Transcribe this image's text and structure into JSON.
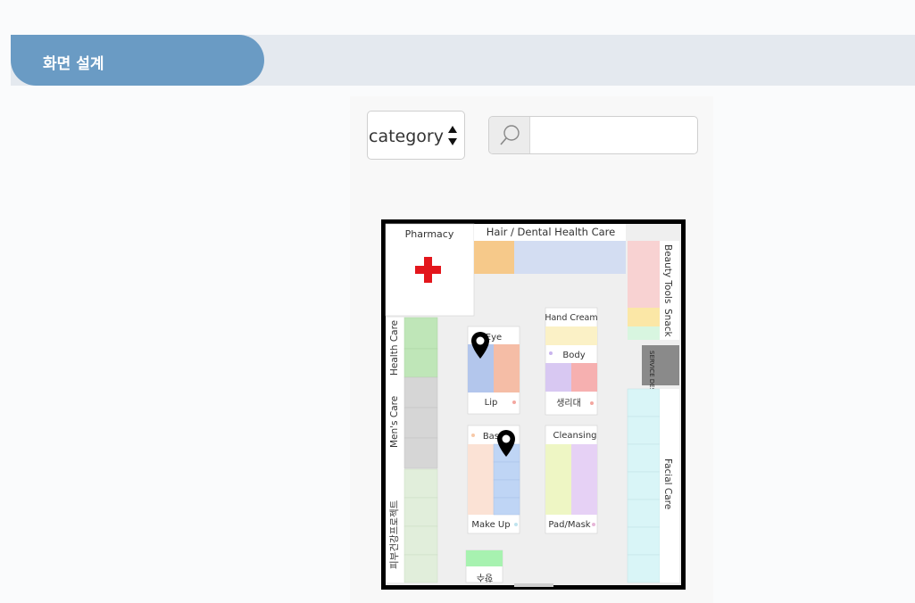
{
  "header": {
    "title": "화면 설계"
  },
  "filter": {
    "category_label": "category",
    "search_placeholder": "",
    "search_value": ""
  },
  "map": {
    "pharmacy": "Pharmacy",
    "hair_dental": "Hair / Dental Health Care",
    "beauty_tools": "Beauty Tools",
    "snack": "Snack",
    "service_desk": "SERVICE DESK",
    "facial_care": "Facial Care",
    "health_care": "Health Care",
    "mens_care": "Men's Care",
    "skin_health": "피부건강프로젝트",
    "eye": "Eye",
    "lip": "Lip",
    "hand_cream": "Hand Cream",
    "body": "Body",
    "sanitary": "생리대",
    "base": "Base",
    "make_up": "Make Up",
    "cleansing": "Cleansing",
    "pad_mask": "Pad/Mask",
    "perfume": "향수",
    "colors": {
      "pharmacy_cross": "#e3161c",
      "marker": "#000000",
      "shelf_green": "#bfe6b8",
      "shelf_grey": "#d6d6d6",
      "service_desk": "#8a8a8a",
      "aisle_floor": "#efefef"
    }
  }
}
